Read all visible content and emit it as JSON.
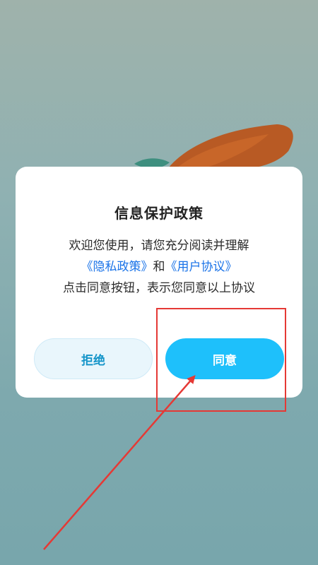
{
  "dialog": {
    "title": "信息保护政策",
    "line1": "欢迎您使用，请您充分阅读并理解",
    "privacy_link": "《隐私政策》",
    "conjunction": "和",
    "user_agreement_link": "《用户协议》",
    "line3": "点击同意按钮，表示您同意以上协议",
    "reject_label": "拒绝",
    "agree_label": "同意"
  },
  "colors": {
    "link": "#1a73e8",
    "agree_button": "#1ec0fb",
    "reject_text": "#1595c9",
    "annotation": "#e53935"
  },
  "icons": {
    "background_art": "carrot-illustration-icon"
  }
}
